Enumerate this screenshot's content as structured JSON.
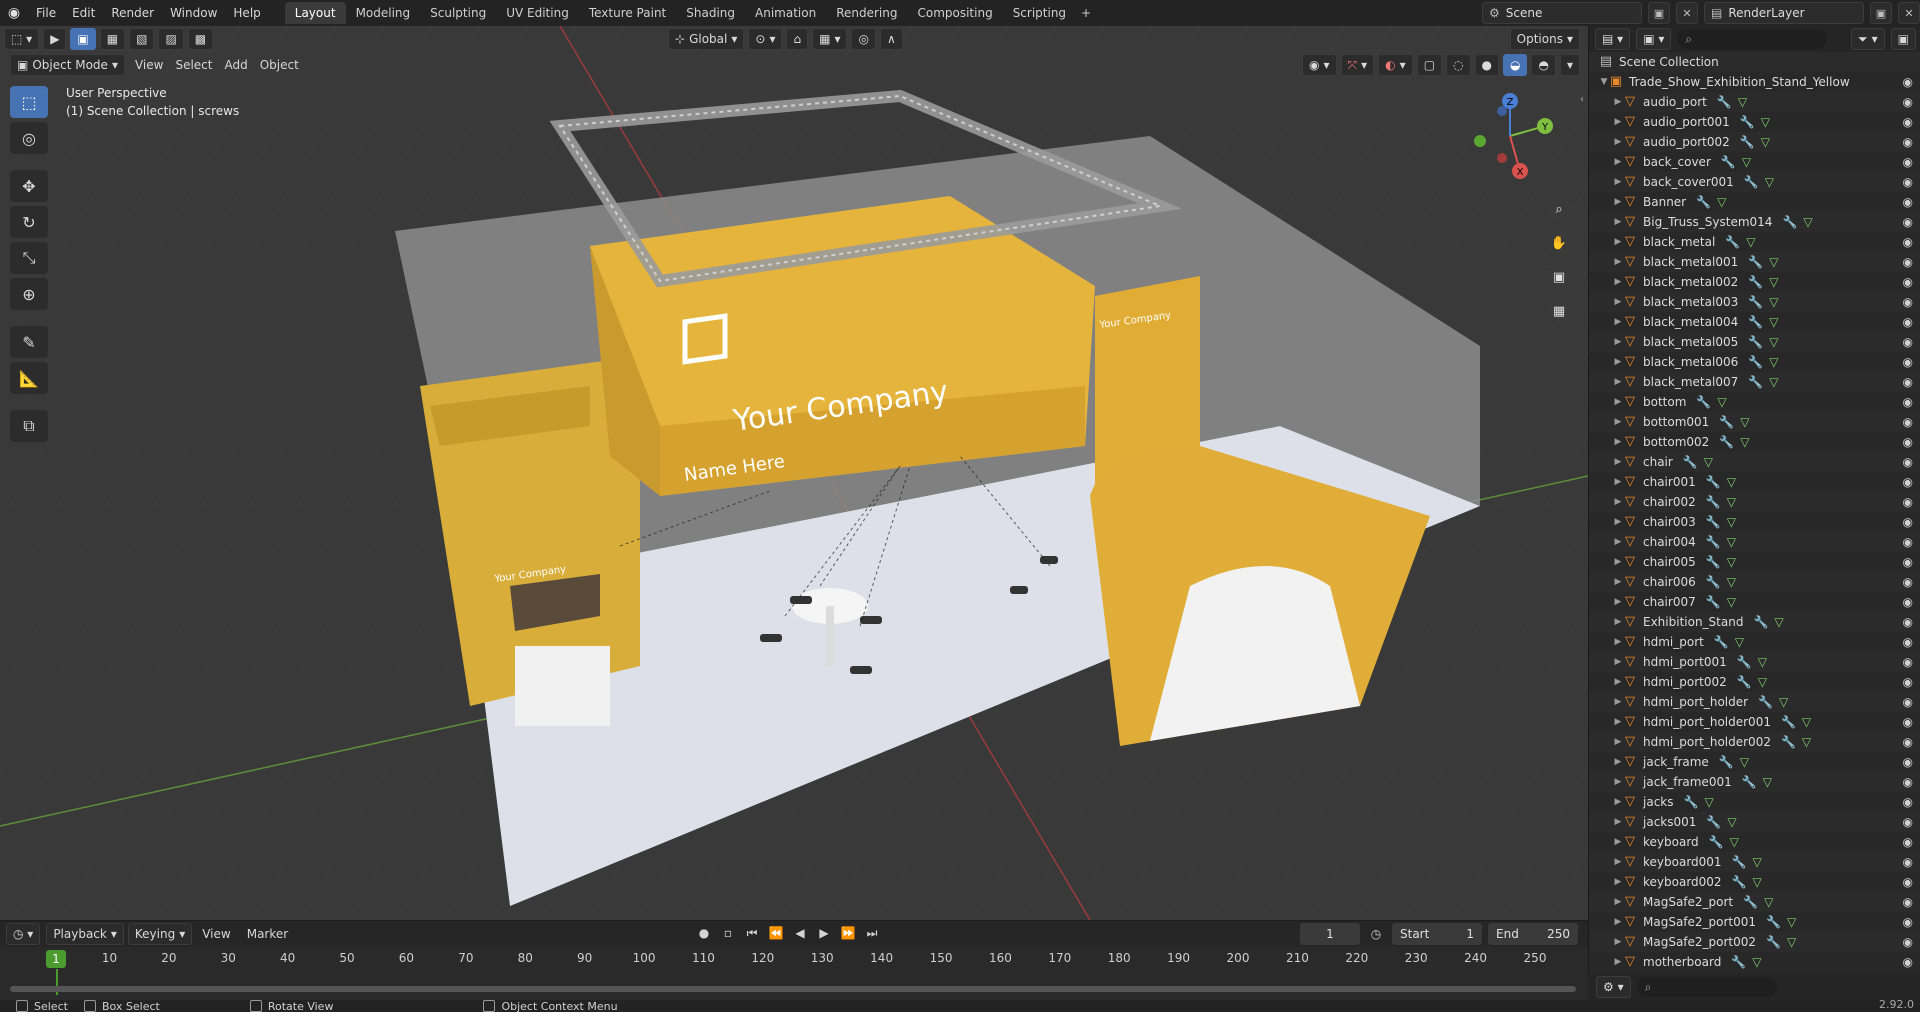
{
  "topbar": {
    "menus": [
      "File",
      "Edit",
      "Render",
      "Window",
      "Help"
    ],
    "workspaces": [
      "Layout",
      "Modeling",
      "Sculpting",
      "UV Editing",
      "Texture Paint",
      "Shading",
      "Animation",
      "Rendering",
      "Compositing",
      "Scripting"
    ],
    "active_workspace": "Layout",
    "scene_name": "Scene",
    "view_layer": "RenderLayer"
  },
  "viewport": {
    "mode": "Object Mode",
    "menus": [
      "View",
      "Select",
      "Add",
      "Object"
    ],
    "transform_orientation": "Global",
    "options_label": "Options",
    "perspective_label": "User Perspective",
    "collection_label": "(1) Scene Collection | screws",
    "booth": {
      "brand_main": "Your Company",
      "brand_sub": "Name Here",
      "brand_small": "Your Company"
    },
    "gizmo": {
      "x": "X",
      "y": "Y",
      "z": "Z"
    }
  },
  "timeline": {
    "menus": [
      "Playback",
      "Keying",
      "View",
      "Marker"
    ],
    "current_frame": "1",
    "start_label": "Start",
    "start_value": "1",
    "end_label": "End",
    "end_value": "250",
    "ruler_marks": [
      "1",
      "10",
      "20",
      "30",
      "40",
      "50",
      "60",
      "70",
      "80",
      "90",
      "100",
      "110",
      "120",
      "130",
      "140",
      "150",
      "160",
      "170",
      "180",
      "190",
      "200",
      "210",
      "220",
      "230",
      "240",
      "250"
    ]
  },
  "status": {
    "select": "Select",
    "box_select": "Box Select",
    "rotate_view": "Rotate View",
    "context_menu": "Object Context Menu",
    "version": "2.92.0"
  },
  "outliner": {
    "root": "Scene Collection",
    "collection": "Trade_Show_Exhibition_Stand_Yellow",
    "items": [
      "audio_port",
      "audio_port001",
      "audio_port002",
      "back_cover",
      "back_cover001",
      "Banner",
      "Big_Truss_System014",
      "black_metal",
      "black_metal001",
      "black_metal002",
      "black_metal003",
      "black_metal004",
      "black_metal005",
      "black_metal006",
      "black_metal007",
      "bottom",
      "bottom001",
      "bottom002",
      "chair",
      "chair001",
      "chair002",
      "chair003",
      "chair004",
      "chair005",
      "chair006",
      "chair007",
      "Exhibition_Stand",
      "hdmi_port",
      "hdmi_port001",
      "hdmi_port002",
      "hdmi_port_holder",
      "hdmi_port_holder001",
      "hdmi_port_holder002",
      "jack_frame",
      "jack_frame001",
      "jacks",
      "jacks001",
      "keyboard",
      "keyboard001",
      "keyboard002",
      "MagSafe2_port",
      "MagSafe2_port001",
      "MagSafe2_port002",
      "motherboard"
    ]
  }
}
